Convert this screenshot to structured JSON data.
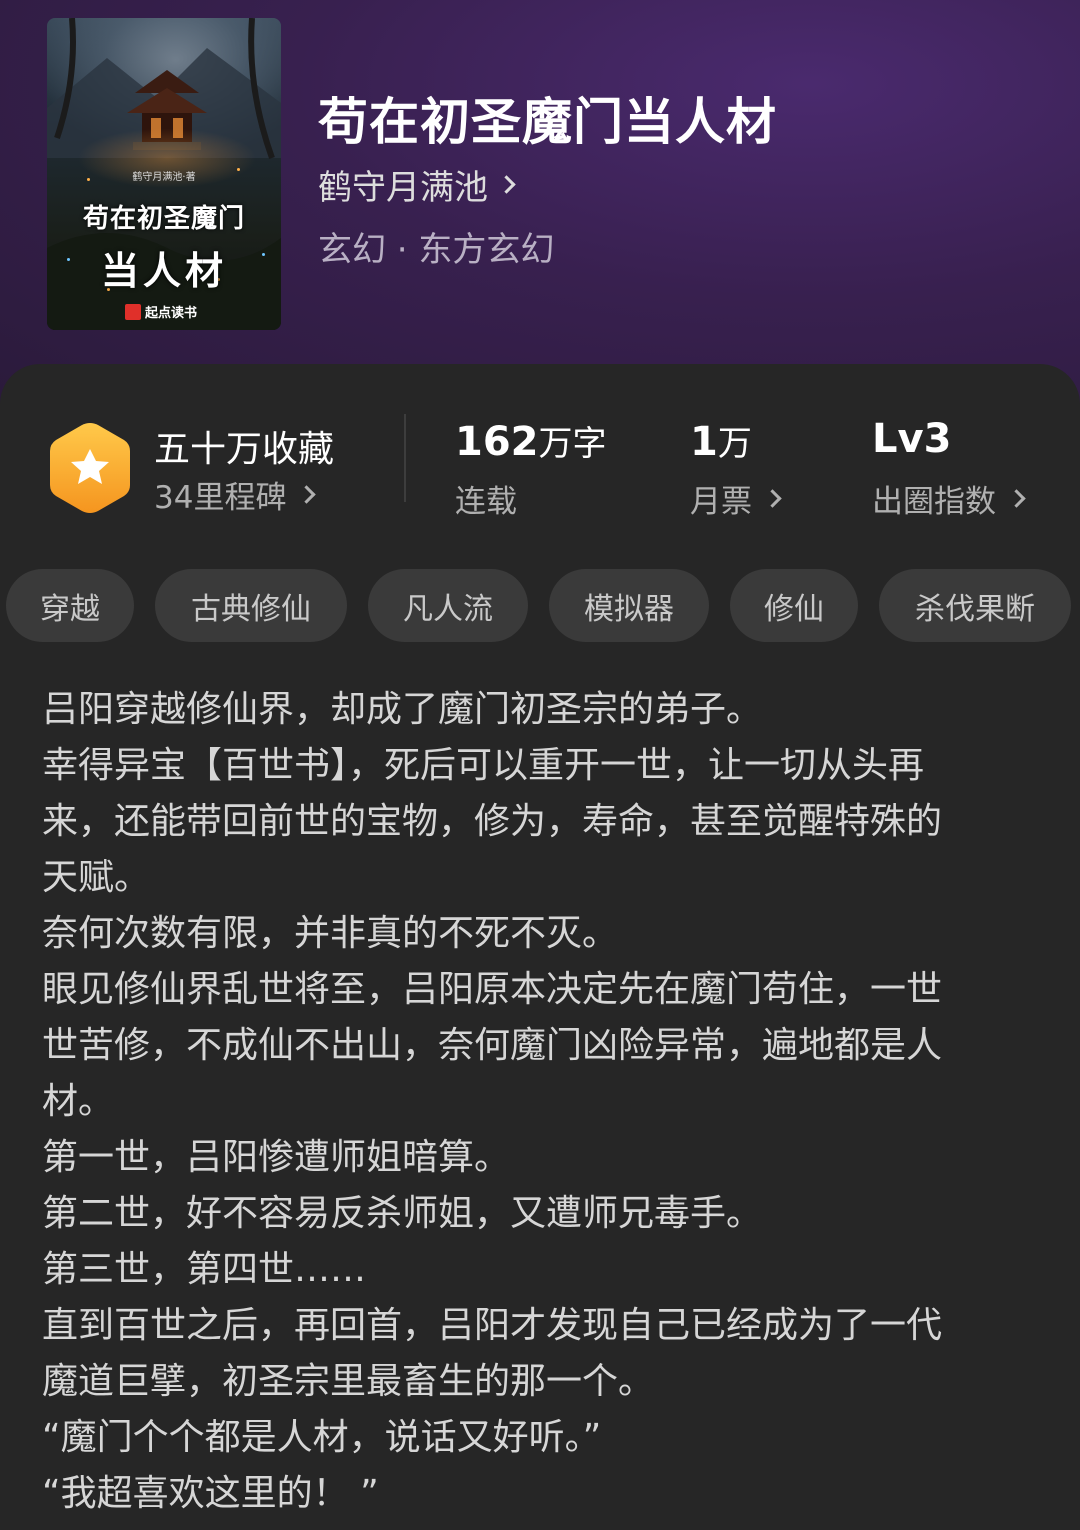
{
  "book": {
    "title": "苟在初圣魔门当人材",
    "author": "鹤守月满池",
    "genre": "玄幻 · 东方玄幻",
    "cover": {
      "author_line": "鹤守月满池·著",
      "title_line1": "苟在初圣魔门",
      "title_line2": "当人材",
      "publisher": "起点读书"
    }
  },
  "stats": {
    "collection": "五十万收藏",
    "milestone": "34里程碑",
    "words_num": "162",
    "words_unit": "万字",
    "words_label": "连载",
    "tickets_num": "1",
    "tickets_unit": "万",
    "tickets_label": "月票",
    "level_num": "Lv3",
    "level_label": "出圈指数"
  },
  "tags": [
    "穿越",
    "古典修仙",
    "凡人流",
    "模拟器",
    "修仙",
    "杀伐果断"
  ],
  "synopsis": [
    "吕阳穿越修仙界，却成了魔门初圣宗的弟子。",
    "幸得异宝【百世书】，死后可以重开一世，让一切从头再",
    "来，还能带回前世的宝物，修为，寿命，甚至觉醒特殊的",
    "天赋。",
    "奈何次数有限，并非真的不死不灭。",
    "眼见修仙界乱世将至，吕阳原本决定先在魔门苟住，一世",
    "世苦修，不成仙不出山，奈何魔门凶险异常，遍地都是人",
    "材。",
    "第一世，吕阳惨遭师姐暗算。",
    "第二世，好不容易反杀师姐，又遭师兄毒手。",
    "第三世，第四世……",
    "直到百世之后，再回首，吕阳才发现自己已经成为了一代",
    "魔道巨擘，初圣宗里最畜生的那一个。",
    "“魔门个个都是人材，说话又好听。”",
    "“我超喜欢这里的！ ”"
  ],
  "colors": {
    "header_purple": "#38204f",
    "panel_bg": "#262626",
    "tag_bg": "#3a3a3a",
    "badge_orange": "#f5a623"
  }
}
